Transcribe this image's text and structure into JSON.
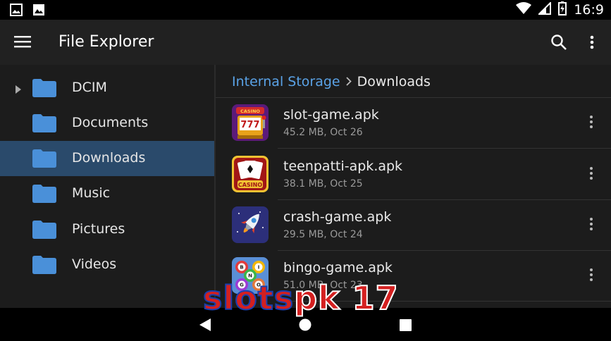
{
  "status_bar": {
    "time": "16:9",
    "icons": [
      "image-icon",
      "photo-icon",
      "wifi-icon",
      "signal-icon",
      "battery-icon"
    ]
  },
  "app_bar": {
    "title": "File Explorer",
    "icons": [
      "menu-icon",
      "search-icon",
      "more-vert-icon"
    ]
  },
  "sidebar": {
    "items": [
      {
        "label": "DCIM",
        "expandable": true,
        "active": false
      },
      {
        "label": "Documents",
        "expandable": false,
        "active": false
      },
      {
        "label": "Downloads",
        "expandable": false,
        "active": true
      },
      {
        "label": "Music",
        "expandable": false,
        "active": false
      },
      {
        "label": "Pictures",
        "expandable": false,
        "active": false
      },
      {
        "label": "Videos",
        "expandable": false,
        "active": false
      }
    ]
  },
  "breadcrumb": {
    "root": "Internal Storage",
    "separator": ">",
    "current": "Downloads"
  },
  "files": [
    {
      "name": "slot-game.apk",
      "meta": "45.2 MB, Oct 26",
      "icon": "slot-machine-icon"
    },
    {
      "name": "teenpatti-apk.apk",
      "meta": "38.1 MB, Oct 25",
      "icon": "casino-cards-icon"
    },
    {
      "name": "crash-game.apk",
      "meta": "29.5 MB, Oct 24",
      "icon": "rocket-icon"
    },
    {
      "name": "bingo-game.apk",
      "meta": "51.0 MB, Oct 23",
      "icon": "bingo-balls-icon"
    }
  ],
  "thumb_text": {
    "slot_top": "CASINO",
    "slot_reels": "777",
    "cards_label": "CASINO",
    "bingo_letters": [
      "B",
      "I",
      "N",
      "G",
      "O"
    ]
  },
  "watermark": {
    "part_a": "slots",
    "part_b": "pk 17"
  },
  "colors": {
    "accent": "#5aa2e6",
    "active_row": "#2a4a6b",
    "folder": "#4a90d9",
    "app_bar": "#212121",
    "panel": "#1c1c1c"
  }
}
